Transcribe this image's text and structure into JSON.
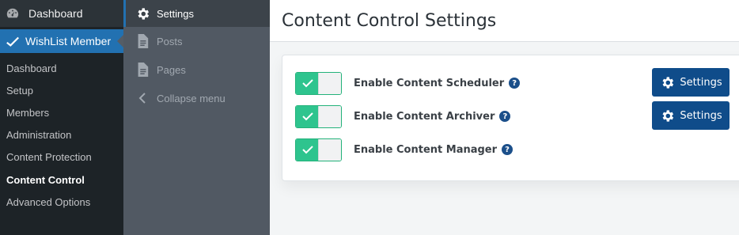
{
  "wp_menu": {
    "top_item": {
      "label": "Dashboard",
      "icon": "gauge-icon"
    },
    "active_item": {
      "label": "WishList Member",
      "icon": "checkmark-icon"
    },
    "sub_items": [
      {
        "label": "Dashboard"
      },
      {
        "label": "Setup"
      },
      {
        "label": "Members"
      },
      {
        "label": "Administration"
      },
      {
        "label": "Content Protection"
      },
      {
        "label": "Content Control",
        "current": true
      },
      {
        "label": "Advanced Options"
      }
    ]
  },
  "sub_menu": {
    "items": [
      {
        "label": "Settings",
        "icon": "gear-icon",
        "active": true
      },
      {
        "label": "Posts",
        "icon": "document-icon"
      },
      {
        "label": "Pages",
        "icon": "document-icon"
      },
      {
        "label": "Collapse menu",
        "icon": "chevron-left-icon"
      }
    ]
  },
  "main": {
    "title": "Content Control Settings",
    "rows": [
      {
        "label": "Enable Content Scheduler",
        "enabled": true,
        "help": "?",
        "settings_label": "Settings",
        "has_settings": true
      },
      {
        "label": "Enable Content Archiver",
        "enabled": true,
        "help": "?",
        "settings_label": "Settings",
        "has_settings": true
      },
      {
        "label": "Enable Content Manager",
        "enabled": true,
        "help": "?",
        "has_settings": false
      }
    ]
  },
  "colors": {
    "wp_active": "#2271b1",
    "toggle_on": "#2ec48e",
    "button": "#0f4c8a"
  }
}
